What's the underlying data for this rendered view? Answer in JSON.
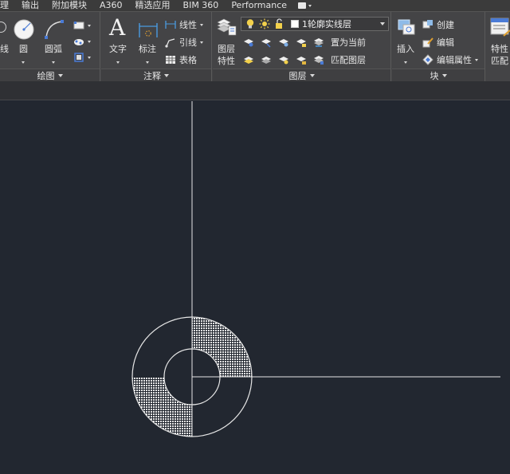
{
  "menubar": {
    "tabs": [
      "理",
      "输出",
      "附加模块",
      "A360",
      "精选应用",
      "BIM 360",
      "Performance"
    ]
  },
  "ribbon": {
    "draw": {
      "title": "绘图",
      "line_label": "线",
      "circle_label": "圆",
      "arc_label": "圆弧"
    },
    "annotation": {
      "title": "注释",
      "text_label": "文字",
      "dimension_label": "标注",
      "linear_label": "线性",
      "leader_label": "引线",
      "table_label": "表格"
    },
    "layers": {
      "title": "图层",
      "properties_label": "图层",
      "properties_label2": "特性",
      "current_layer": "1轮廓实线层",
      "set_current_label": "置为当前",
      "match_layer_label": "匹配图层"
    },
    "block": {
      "title": "块",
      "insert_label": "插入",
      "create_label": "创建",
      "edit_label": "编辑",
      "edit_attributes_label": "编辑属性"
    },
    "properties": {
      "properties_label": "特性",
      "match_label": "匹配"
    }
  },
  "colors": {
    "canvas_bg": "#222730",
    "ribbon_bg": "#444446",
    "drawing_line": "#e6e6e6",
    "bulb_yellow": "#f2d04b"
  }
}
